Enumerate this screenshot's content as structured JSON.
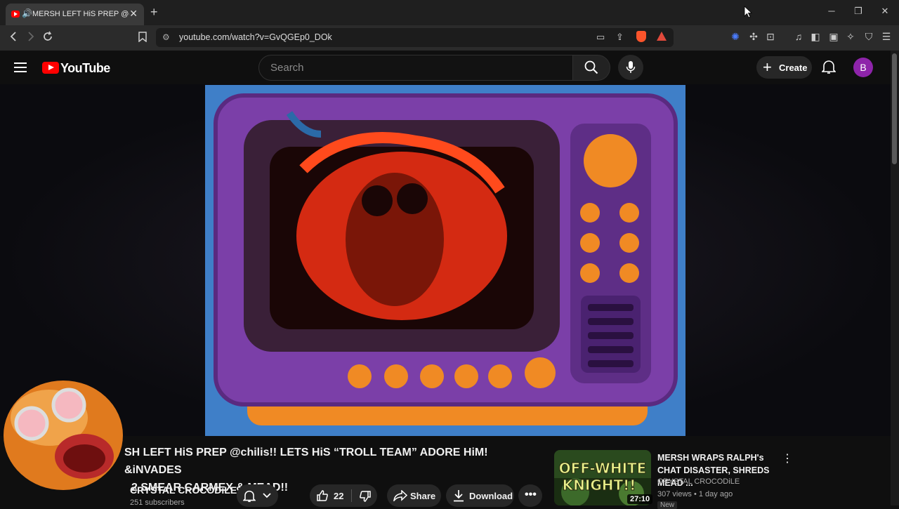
{
  "browser": {
    "tab_title": "MERSH LEFT HiS PREP @chili",
    "url": "youtube.com/watch?v=GvQGEp0_DOk"
  },
  "header": {
    "logo_text": "YouTube",
    "search_placeholder": "Search",
    "create_label": "Create",
    "avatar_letter": "B"
  },
  "video": {
    "title_line1": "SH LEFT HiS PREP @chilis!! LETS HiS “TROLL TEAM” ADORE HiM! &iNVADES",
    "title_line2": "2 SMEAR CARMEX & MEAD!!",
    "channel": "CRYSTAL CROCODiLE",
    "subscribers": "251 subscribers",
    "likes": "22",
    "share_label": "Share",
    "download_label": "Download"
  },
  "recommended": {
    "title": "MERSH WRAPS RALPH's CHAT DISASTER, SHREDS MEAD ...",
    "channel": "CRYSTAL CROCODiLE",
    "meta": "307 views • 1 day ago",
    "badge": "New",
    "duration": "27:10",
    "thumb_text_1": "OFF-WHITE",
    "thumb_text_2": "KNIGHT!!"
  }
}
